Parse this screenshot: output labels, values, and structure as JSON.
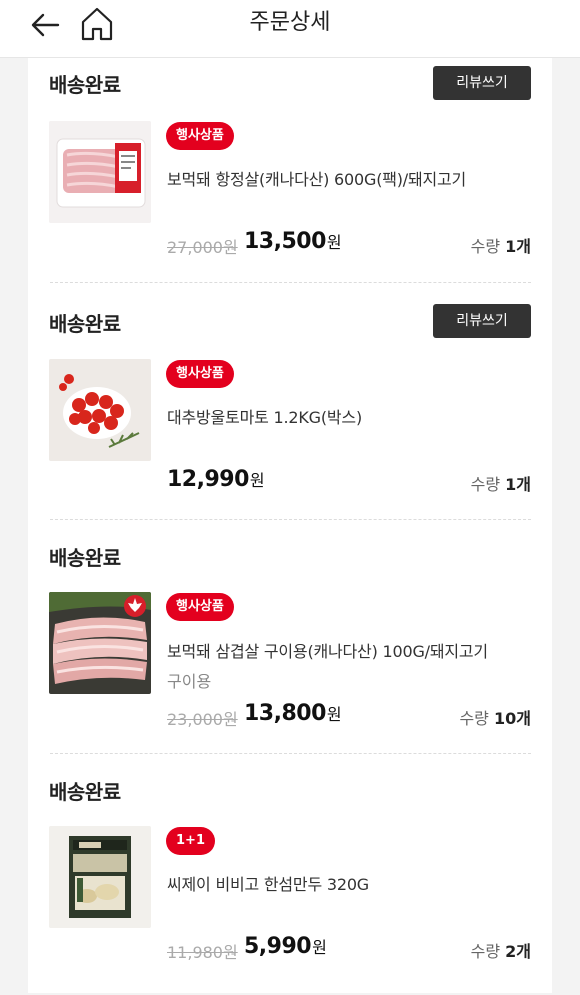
{
  "header": {
    "title": "주문상세",
    "back_icon": "arrow-left-icon",
    "home_icon": "home-icon"
  },
  "colors": {
    "badge": "#e3001e",
    "review_button": "#333333",
    "strike_price": "#aaaaaa"
  },
  "orders": [
    {
      "status": "배송완료",
      "review_label": "리뷰쓰기",
      "badge": "행사상품",
      "name": "보먹돼 항정살(캐나다산) 600G(팩)/돼지고기",
      "original_price": "27,000원",
      "price": "13,500",
      "currency": "원",
      "qty_label": "수량",
      "qty_value": "1개"
    },
    {
      "status": "배송완료",
      "review_label": "리뷰쓰기",
      "badge": "행사상품",
      "name": "대추방울토마토 1.2KG(박스)",
      "price": "12,990",
      "currency": "원",
      "qty_label": "수량",
      "qty_value": "1개"
    },
    {
      "status": "배송완료",
      "badge": "행사상품",
      "name": "보먹돼 삼겹살 구이용(캐나다산) 100G/돼지고기",
      "subtitle": "구이용",
      "original_price": "23,000원",
      "price": "13,800",
      "currency": "원",
      "qty_label": "수량",
      "qty_value": "10개"
    },
    {
      "status": "배송완료",
      "badge": "1+1",
      "name": "씨제이 비비고 한섬만두 320G",
      "original_price": "11,980원",
      "price": "5,990",
      "currency": "원",
      "qty_label": "수량",
      "qty_value": "2개"
    }
  ]
}
